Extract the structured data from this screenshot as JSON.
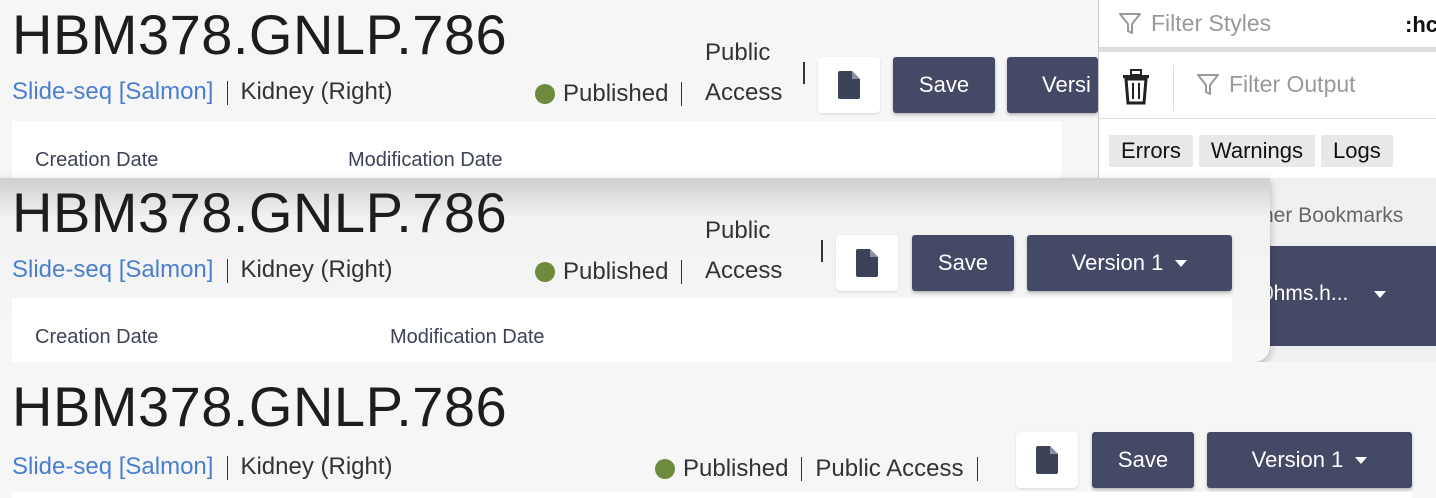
{
  "dataset": {
    "id": "HBM378.GNLP.786",
    "assay": "Slide-seq [Salmon]",
    "organ": "Kidney (Right)",
    "status": "Published",
    "access": "Public Access",
    "access_line1": "Public",
    "access_line2": "Access",
    "status_color": "#6e8b3d"
  },
  "toolbar": {
    "save_label": "Save",
    "version_label": "Version 1",
    "version_partial": "Versi",
    "file_icon": "file-icon",
    "caret_icon": "caret-down-icon"
  },
  "table": {
    "col1": "Creation Date",
    "col2": "Modification Date"
  },
  "devtools": {
    "filter_styles_placeholder": "Filter Styles",
    "hov_label": ":hc",
    "filter_output_placeholder": "Filter Output",
    "chips": [
      "Errors",
      "Warnings",
      "Logs"
    ]
  },
  "browser": {
    "bookmarks_partial": "her Bookmarks",
    "account_partial": "0hms.h..."
  },
  "colors": {
    "button": "#444a65",
    "link": "#4a7fd0"
  }
}
